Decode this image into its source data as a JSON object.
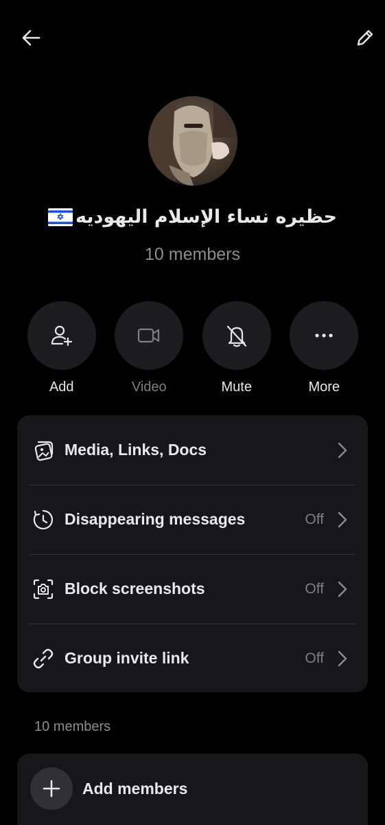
{
  "header": {
    "back_icon": "arrow-left-icon",
    "edit_icon": "pencil-icon"
  },
  "group": {
    "name": "حظيره نساء الإسلام اليهوديه",
    "flag": "israel-flag",
    "member_count": "10 members"
  },
  "actions": [
    {
      "label": "Add",
      "icon": "add-user-icon",
      "enabled": true
    },
    {
      "label": "Video",
      "icon": "video-camera-icon",
      "enabled": false
    },
    {
      "label": "Mute",
      "icon": "bell-off-icon",
      "enabled": true
    },
    {
      "label": "More",
      "icon": "more-horizontal-icon",
      "enabled": true
    }
  ],
  "settings": [
    {
      "label": "Media, Links, Docs",
      "value": "",
      "icon": "media-icon"
    },
    {
      "label": "Disappearing messages",
      "value": "Off",
      "icon": "timer-icon"
    },
    {
      "label": "Block screenshots",
      "value": "Off",
      "icon": "screenshot-camera-icon"
    },
    {
      "label": "Group invite link",
      "value": "Off",
      "icon": "link-icon"
    }
  ],
  "members_section": {
    "title": "10 members",
    "add_label": "Add members",
    "add_icon": "plus-icon"
  },
  "colors": {
    "background": "#000000",
    "card": "#16171a",
    "action_circle": "#1c1d20",
    "text_primary": "#e7e9ea",
    "text_secondary": "#8b8d91",
    "divider": "#34363a"
  }
}
